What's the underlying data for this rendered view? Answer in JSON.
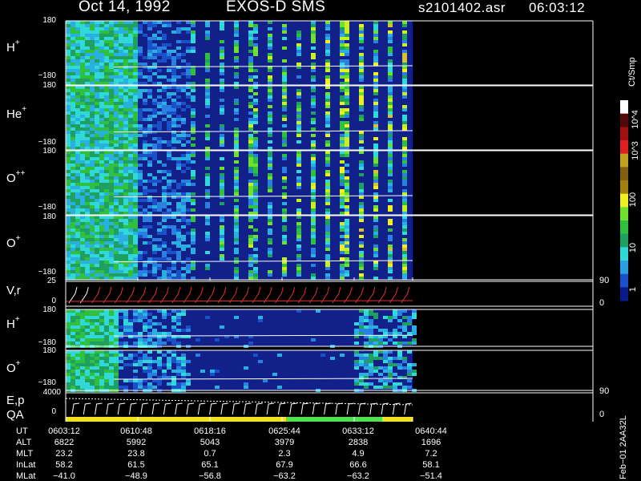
{
  "header": {
    "date": "Oct 14, 1992",
    "instrument": "EXOS-D SMS",
    "file": "s2101402.asr",
    "time": "06:03:12"
  },
  "colorbar": {
    "unit": "Ct/Smp",
    "ticks": [
      "1",
      "10",
      "100",
      "10^3",
      "10^4"
    ],
    "colors": [
      "#0a1a8a",
      "#1a50c8",
      "#2aa0e0",
      "#30d8d8",
      "#20a060",
      "#30c040",
      "#70e030",
      "#f0f020",
      "#a08010",
      "#806010",
      "#c0a020",
      "#e02020",
      "#a01010",
      "#500808",
      "#fff"
    ]
  },
  "panels": [
    {
      "label": "H",
      "sup": "+",
      "ytop": "180",
      "ybot": "−180"
    },
    {
      "label": "He",
      "sup": "+",
      "ytop": "180",
      "ybot": "−180"
    },
    {
      "label": "O",
      "sup": "++",
      "ytop": "180",
      "ybot": "−180"
    },
    {
      "label": "O",
      "sup": "+",
      "ytop": "180",
      "ybot": "−180"
    }
  ],
  "vr_panel": {
    "label": "V,r",
    "ytop": "25",
    "ybot": "0",
    "rtop": "90",
    "rbot": "0"
  },
  "lower_panels": [
    {
      "label": "H",
      "sup": "+",
      "ytop": "180",
      "ybot": "−180"
    },
    {
      "label": "O",
      "sup": "+",
      "ytop": "180",
      "ybot": "−180"
    }
  ],
  "ep_panel": {
    "label1": "E,p",
    "label2": "QA",
    "ytop": "4000",
    "ybot": "0",
    "rtop": "90",
    "rbot": "0"
  },
  "footer": {
    "row_labels": [
      "UT",
      "ALT",
      "MLT",
      "InLat",
      "MLat"
    ],
    "columns": [
      [
        "0603:12",
        "6822",
        "23.2",
        "58.2",
        "−41.0"
      ],
      [
        "0610:48",
        "5992",
        "23.8",
        "61.5",
        "−48.9"
      ],
      [
        "0618:16",
        "5043",
        "0.7",
        "65.1",
        "−56.8"
      ],
      [
        "0625:44",
        "3979",
        "2.3",
        "67.9",
        "−63.2"
      ],
      [
        "0633:12",
        "2838",
        "4.9",
        "66.6",
        "−63.2"
      ],
      [
        "0640:44",
        "1696",
        "7.2",
        "58.1",
        "−51.4"
      ]
    ]
  },
  "side_label": "Feb−01  2AA32L",
  "chart_data": {
    "type": "heatmap",
    "title": "Oct 14, 1992    EXOS-D SMS",
    "time_ticks": [
      "0603:12",
      "0610:48",
      "0618:16",
      "0625:44",
      "0633:12",
      "0640:44"
    ],
    "y_range": [
      -180,
      180
    ],
    "color_scale": "log",
    "color_range": [
      1,
      10000
    ],
    "series": [
      {
        "name": "H+"
      },
      {
        "name": "He+"
      },
      {
        "name": "O++"
      },
      {
        "name": "O+"
      },
      {
        "name": "V,r"
      },
      {
        "name": "H+"
      },
      {
        "name": "O+"
      },
      {
        "name": "E,p"
      }
    ]
  }
}
